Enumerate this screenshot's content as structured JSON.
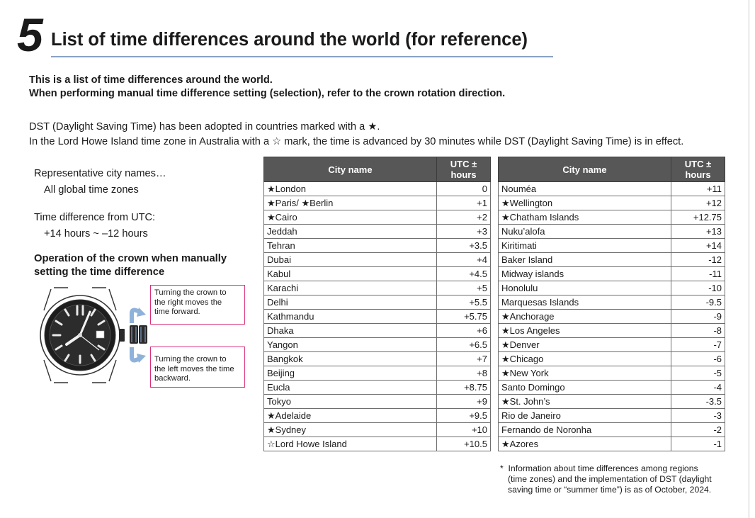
{
  "section": {
    "number": "5",
    "title": "List of time differences around the world (for reference)"
  },
  "intro": {
    "line1": "This is a list of time differences around the world.",
    "line2": "When performing manual time difference setting (selection), refer to the crown rotation direction."
  },
  "dst_note": {
    "line1": "DST (Daylight Saving Time) has been adopted in countries marked with a ★.",
    "line2": "In the Lord Howe Island time zone in Australia with a ☆ mark, the time is advanced by 30 minutes while DST (Daylight Saving Time) is in effect."
  },
  "left_info": {
    "rep_label": "Representative city names…",
    "rep_value": "All global time zones",
    "diff_label": "Time difference from UTC:",
    "diff_value": "+14 hours ~ –12 hours",
    "crown_heading_1": "Operation of the crown when manually",
    "crown_heading_2": "setting the time difference"
  },
  "callouts": {
    "right": [
      "Turning the crown to",
      "the right moves the",
      "time forward."
    ],
    "left": [
      "Turning the crown to",
      "the left moves the time",
      "backward."
    ]
  },
  "table_headers": {
    "city": "City name",
    "utc_line1": "UTC ±",
    "utc_line2": "hours"
  },
  "table1": [
    {
      "city": "★London",
      "utc": "0"
    },
    {
      "city": "★Paris/ ★Berlin",
      "utc": "+1"
    },
    {
      "city": "★Cairo",
      "utc": "+2"
    },
    {
      "city": "Jeddah",
      "utc": "+3"
    },
    {
      "city": "Tehran",
      "utc": "+3.5"
    },
    {
      "city": "Dubai",
      "utc": "+4"
    },
    {
      "city": "Kabul",
      "utc": "+4.5"
    },
    {
      "city": "Karachi",
      "utc": "+5"
    },
    {
      "city": "Delhi",
      "utc": "+5.5"
    },
    {
      "city": "Kathmandu",
      "utc": "+5.75"
    },
    {
      "city": "Dhaka",
      "utc": "+6"
    },
    {
      "city": "Yangon",
      "utc": "+6.5"
    },
    {
      "city": "Bangkok",
      "utc": "+7"
    },
    {
      "city": "Beijing",
      "utc": "+8"
    },
    {
      "city": "Eucla",
      "utc": "+8.75"
    },
    {
      "city": "Tokyo",
      "utc": "+9"
    },
    {
      "city": "★Adelaide",
      "utc": "+9.5"
    },
    {
      "city": "★Sydney",
      "utc": "+10"
    },
    {
      "city": "☆Lord Howe Island",
      "utc": "+10.5"
    }
  ],
  "table2": [
    {
      "city": "Nouméa",
      "utc": "+11"
    },
    {
      "city": "★Wellington",
      "utc": "+12"
    },
    {
      "city": "★Chatham Islands",
      "utc": "+12.75"
    },
    {
      "city": "Nuku’alofa",
      "utc": "+13"
    },
    {
      "city": "Kiritimati",
      "utc": "+14"
    },
    {
      "city": "Baker Island",
      "utc": "-12"
    },
    {
      "city": "Midway islands",
      "utc": "-11"
    },
    {
      "city": "Honolulu",
      "utc": "-10"
    },
    {
      "city": "Marquesas Islands",
      "utc": "-9.5"
    },
    {
      "city": "★Anchorage",
      "utc": "-9"
    },
    {
      "city": "★Los Angeles",
      "utc": "-8"
    },
    {
      "city": "★Denver",
      "utc": "-7"
    },
    {
      "city": "★Chicago",
      "utc": "-6"
    },
    {
      "city": "★New York",
      "utc": "-5"
    },
    {
      "city": "Santo Domingo",
      "utc": "-4"
    },
    {
      "city": "★St. John’s",
      "utc": "-3.5"
    },
    {
      "city": "Rio de Janeiro",
      "utc": "-3"
    },
    {
      "city": "Fernando de Noronha",
      "utc": "-2"
    },
    {
      "city": "★Azores",
      "utc": "-1"
    }
  ],
  "footnote": {
    "marker": "*",
    "line1": "Information about time differences among regions",
    "line2": "(time zones) and the implementation of DST (daylight",
    "line3": "saving time or “summer time”) is as of October, 2024."
  },
  "colors": {
    "header_bg": "#575757",
    "title_rule": "#8aa2c4",
    "callout_border": "#d9307a",
    "arrow_blue": "#8fb2da"
  },
  "icons": [
    "wristwatch-icon",
    "crown-rotate-right-arrow-icon",
    "crown-rotate-left-arrow-icon"
  ]
}
